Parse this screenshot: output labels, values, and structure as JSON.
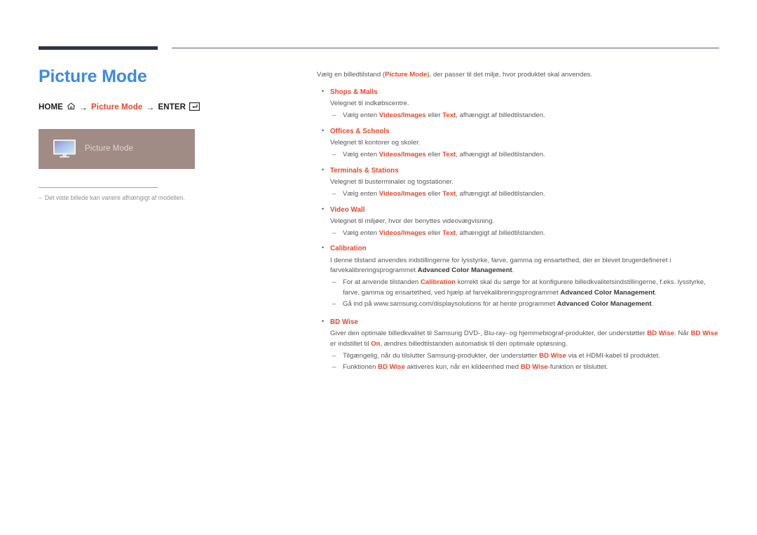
{
  "colors": {
    "title_blue": "#3d8ae5",
    "accent_red": "#e8462a",
    "rule_navy": "#2e3350",
    "placeholder_bg": "#a08b85",
    "body_gray": "#58585a"
  },
  "page": {
    "title": "Picture Mode"
  },
  "nav_path": {
    "home_label": "HOME",
    "home_icon": "home-icon",
    "arrow": "→",
    "target_label": "Picture Mode",
    "enter_label": "ENTER",
    "enter_icon": "enter-key-icon"
  },
  "image_placeholder": {
    "icon": "monitor-icon",
    "label": "Picture Mode"
  },
  "note": {
    "dash": "–",
    "text": "Det viste billede kan variere afhængigt af modellen."
  },
  "content": {
    "intro": {
      "pre": "Vælg en billedtilstand (",
      "term": "Picture Mode",
      "post": "), der passer til det miljø, hvor produktet skal anvendes."
    },
    "bullet_marker": "•",
    "dash_marker": "–",
    "sub_common": {
      "pre": "Vælg enten ",
      "term1": "Videos/Images",
      "mid": " eller ",
      "term2": "Text",
      "post": ", afhængigt af billedtilstanden."
    },
    "items": [
      {
        "title": "Shops & Malls",
        "desc": "Velegnet til indkøbscentre."
      },
      {
        "title": "Offices & Schools",
        "desc": "Velegnet til kontorer og skoler."
      },
      {
        "title": "Terminals & Stations",
        "desc": "Velegnet til busterminaler og togstationer."
      },
      {
        "title": "Video Wall",
        "desc": "Velegnet til miljøer, hvor der benyttes videovægvisning."
      }
    ],
    "calibration": {
      "title": "Calibration",
      "desc_pre": "I denne tilstand anvendes indstillingerne for lysstyrke, farve, gamma og ensartethed, der er blevet brugerdefineret i farvekalibreringsprogrammet ",
      "desc_bold": "Advanced Color Management",
      "desc_post": ".",
      "sub1_pre": "For at anvende tilstanden ",
      "sub1_red": "Calibration",
      "sub1_mid": " korrekt skal du sørge for at konfigurere billedkvalitetsindstillingerne, f.eks. lysstyrke, farve, gamma og ensartethed, ved hjælp af farvekalibreringsprogrammet ",
      "sub1_bold": "Advanced Color Management",
      "sub1_post": ".",
      "sub2_pre": "Gå ind på www.samsung.com/displaysolutions for at hente programmet ",
      "sub2_bold": "Advanced Color Management",
      "sub2_post": "."
    },
    "bdwise": {
      "title": "BD Wise",
      "desc_p1": "Giver den optimale billedkvalitet til Samsung DVD-, Blu-ray- og hjemmebiograf-produkter, der understøtter ",
      "desc_r1": "BD Wise",
      "desc_p2": ". Når ",
      "desc_r2": "BD Wise",
      "desc_p3": " er indstillet til ",
      "desc_r3": "On",
      "desc_p4": ", ændres billedtilstanden automatisk til den optimale opløsning.",
      "sub1_pre": "Tilgængelig, når du tilslutter Samsung-produkter, der understøtter ",
      "sub1_red": "BD Wise",
      "sub1_post": " via et HDMI-kabel til produktet.",
      "sub2_pre": "Funktionen ",
      "sub2_red1": "BD Wise",
      "sub2_mid": " aktiveres kun, når en kildeenhed med ",
      "sub2_red2": "BD Wise",
      "sub2_post": "-funktion er tilsluttet."
    }
  }
}
